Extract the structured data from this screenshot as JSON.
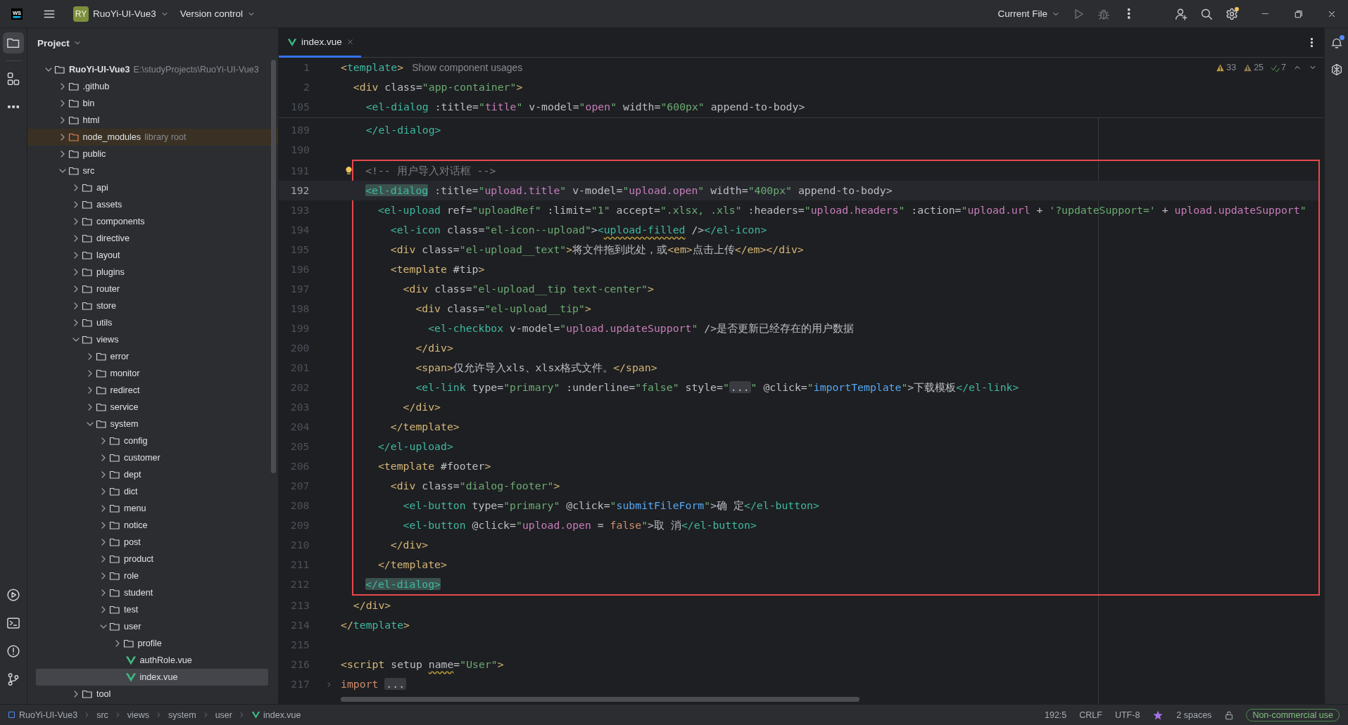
{
  "title_bar": {
    "logo": "WS",
    "project_badge": "RY",
    "project": "RuoYi-UI-Vue3",
    "vcs": "Version control",
    "run_config": "Current File",
    "settings_badge": true
  },
  "left_toolbar": {
    "top": [
      {
        "kind": "project",
        "selected": true
      },
      {
        "kind": "structure",
        "selected": false
      },
      {
        "kind": "more",
        "selected": false
      }
    ],
    "bottom": [
      {
        "kind": "services",
        "selected": false
      },
      {
        "kind": "terminal",
        "selected": false
      },
      {
        "kind": "problems",
        "selected": false
      },
      {
        "kind": "git",
        "selected": false
      }
    ]
  },
  "project_panel": {
    "title": "Project",
    "tree": [
      {
        "name": "RuoYi-UI-Vue3",
        "hint": "E:\\studyProjects\\RuoYi-UI-Vue3",
        "kind": "project",
        "expanded": true,
        "selected": false,
        "children": [
          {
            "name": ".github",
            "kind": "folder",
            "expanded": false,
            "selected": false
          },
          {
            "name": "bin",
            "kind": "folder",
            "expanded": false,
            "selected": false
          },
          {
            "name": "html",
            "kind": "folder",
            "expanded": false,
            "selected": false
          },
          {
            "name": "node_modules",
            "hint": "library root",
            "kind": "library",
            "expanded": false,
            "selected": false
          },
          {
            "name": "public",
            "kind": "folder",
            "expanded": false,
            "selected": false
          },
          {
            "name": "src",
            "kind": "folder",
            "expanded": true,
            "selected": false,
            "children": [
              {
                "name": "api",
                "kind": "folder",
                "expanded": false,
                "selected": false
              },
              {
                "name": "assets",
                "kind": "folder",
                "expanded": false,
                "selected": false
              },
              {
                "name": "components",
                "kind": "folder",
                "expanded": false,
                "selected": false
              },
              {
                "name": "directive",
                "kind": "folder",
                "expanded": false,
                "selected": false
              },
              {
                "name": "layout",
                "kind": "folder",
                "expanded": false,
                "selected": false
              },
              {
                "name": "plugins",
                "kind": "folder",
                "expanded": false,
                "selected": false
              },
              {
                "name": "router",
                "kind": "folder",
                "expanded": false,
                "selected": false
              },
              {
                "name": "store",
                "kind": "folder",
                "expanded": false,
                "selected": false
              },
              {
                "name": "utils",
                "kind": "folder",
                "expanded": false,
                "selected": false
              },
              {
                "name": "views",
                "kind": "folder",
                "expanded": true,
                "selected": false,
                "children": [
                  {
                    "name": "error",
                    "kind": "folder",
                    "expanded": false,
                    "selected": false
                  },
                  {
                    "name": "monitor",
                    "kind": "folder",
                    "expanded": false,
                    "selected": false
                  },
                  {
                    "name": "redirect",
                    "kind": "folder",
                    "expanded": false,
                    "selected": false
                  },
                  {
                    "name": "service",
                    "kind": "folder",
                    "expanded": false,
                    "selected": false
                  },
                  {
                    "name": "system",
                    "kind": "folder",
                    "expanded": true,
                    "selected": false,
                    "children": [
                      {
                        "name": "config",
                        "kind": "folder",
                        "expanded": false,
                        "selected": false
                      },
                      {
                        "name": "customer",
                        "kind": "folder",
                        "expanded": false,
                        "selected": false
                      },
                      {
                        "name": "dept",
                        "kind": "folder",
                        "expanded": false,
                        "selected": false
                      },
                      {
                        "name": "dict",
                        "kind": "folder",
                        "expanded": false,
                        "selected": false
                      },
                      {
                        "name": "menu",
                        "kind": "folder",
                        "expanded": false,
                        "selected": false
                      },
                      {
                        "name": "notice",
                        "kind": "folder",
                        "expanded": false,
                        "selected": false
                      },
                      {
                        "name": "post",
                        "kind": "folder",
                        "expanded": false,
                        "selected": false
                      },
                      {
                        "name": "product",
                        "kind": "folder",
                        "expanded": false,
                        "selected": false
                      },
                      {
                        "name": "role",
                        "kind": "folder",
                        "expanded": false,
                        "selected": false
                      },
                      {
                        "name": "student",
                        "kind": "folder",
                        "expanded": false,
                        "selected": false
                      },
                      {
                        "name": "test",
                        "kind": "folder",
                        "expanded": false,
                        "selected": false
                      },
                      {
                        "name": "user",
                        "kind": "folder",
                        "expanded": true,
                        "selected": false,
                        "children": [
                          {
                            "name": "profile",
                            "kind": "folder",
                            "expanded": false,
                            "selected": false
                          },
                          {
                            "name": "authRole.vue",
                            "kind": "vue",
                            "selected": false
                          },
                          {
                            "name": "index.vue",
                            "kind": "vue",
                            "selected": true
                          }
                        ]
                      }
                    ]
                  }
                ]
              },
              {
                "name": "tool",
                "kind": "folder",
                "expanded": false,
                "selected": false
              }
            ]
          }
        ]
      }
    ]
  },
  "editor": {
    "tabs": [
      {
        "label": "index.vue",
        "selected": true
      }
    ],
    "inspections": [
      {
        "kind": "warning",
        "count": "33"
      },
      {
        "kind": "weak_warning",
        "count": "25"
      },
      {
        "kind": "typo",
        "count": "7"
      }
    ],
    "sticky_lines": [
      {
        "number": "1",
        "code": [
          {
            "kind": "tag",
            "text": "<"
          },
          {
            "kind": "comp",
            "text": "template"
          },
          {
            "kind": "tag",
            "text": ">"
          }
        ],
        "hint": "Show component usages"
      },
      {
        "number": "2",
        "code": [
          {
            "kind": "tag",
            "text": "  <div"
          },
          {
            "kind": "attr",
            "text": " class="
          },
          {
            "kind": "str",
            "text": "\"app-container\""
          },
          {
            "kind": "tag",
            "text": ">"
          }
        ]
      },
      {
        "number": "105",
        "code": [
          {
            "kind": "comp",
            "text": "    <el-dialog"
          },
          {
            "kind": "attr",
            "text": " :title="
          },
          {
            "kind": "str",
            "text": "\""
          },
          {
            "kind": "var",
            "text": "title"
          },
          {
            "kind": "str",
            "text": "\""
          },
          {
            "kind": "attr",
            "text": " v-model="
          },
          {
            "kind": "str",
            "text": "\""
          },
          {
            "kind": "var",
            "text": "open"
          },
          {
            "kind": "str",
            "text": "\""
          },
          {
            "kind": "attr",
            "text": " width="
          },
          {
            "kind": "str",
            "text": "\"600px\""
          },
          {
            "kind": "attr",
            "text": " append-to-body>"
          }
        ]
      }
    ],
    "lines": [
      {
        "number": "189",
        "current": false,
        "boxed": false,
        "code": [
          {
            "kind": "comp",
            "text": "    </el-dialog>"
          }
        ]
      },
      {
        "number": "190",
        "current": false
      },
      {
        "number": "191",
        "current": false,
        "boxed": true,
        "code": [
          {
            "kind": "comment",
            "text": "    <!-- 用户导入对话框 -->"
          }
        ]
      },
      {
        "number": "192",
        "current": true,
        "boxed": true,
        "code": [
          {
            "kind": "compmatch",
            "text": "    <el-dialog"
          },
          {
            "kind": "attr",
            "text": " :title="
          },
          {
            "kind": "str",
            "text": "\""
          },
          {
            "kind": "var",
            "text": "upload.title"
          },
          {
            "kind": "str",
            "text": "\""
          },
          {
            "kind": "attr",
            "text": " v-model="
          },
          {
            "kind": "str",
            "text": "\""
          },
          {
            "kind": "var",
            "text": "upload.open"
          },
          {
            "kind": "str",
            "text": "\""
          },
          {
            "kind": "attr",
            "text": " width="
          },
          {
            "kind": "str",
            "text": "\"400px\""
          },
          {
            "kind": "attr",
            "text": " append-to-body>"
          }
        ]
      },
      {
        "number": "193",
        "current": false,
        "boxed": true,
        "code": [
          {
            "kind": "comp",
            "text": "      <el-upload"
          },
          {
            "kind": "attr",
            "text": " ref="
          },
          {
            "kind": "str",
            "text": "\"uploadRef\""
          },
          {
            "kind": "attr",
            "text": " :limit="
          },
          {
            "kind": "str",
            "text": "\"1\""
          },
          {
            "kind": "attr",
            "text": " accept="
          },
          {
            "kind": "str",
            "text": "\".xlsx, .xls\""
          },
          {
            "kind": "attr",
            "text": " :headers="
          },
          {
            "kind": "str",
            "text": "\""
          },
          {
            "kind": "var",
            "text": "upload.headers"
          },
          {
            "kind": "str",
            "text": "\""
          },
          {
            "kind": "attr",
            "text": " :action="
          },
          {
            "kind": "str",
            "text": "\""
          },
          {
            "kind": "var",
            "text": "upload.url"
          },
          {
            "kind": "text",
            "text": " + "
          },
          {
            "kind": "str",
            "text": "'?updateSupport='"
          },
          {
            "kind": "text",
            "text": " + "
          },
          {
            "kind": "var",
            "text": "upload.updateSupport"
          },
          {
            "kind": "str",
            "text": "\""
          }
        ]
      },
      {
        "number": "194",
        "current": false,
        "boxed": true,
        "code": [
          {
            "kind": "comp",
            "text": "        <el-icon"
          },
          {
            "kind": "attr",
            "text": " class="
          },
          {
            "kind": "str",
            "text": "\"el-icon--upload\""
          },
          {
            "kind": "attr",
            "text": ">"
          },
          {
            "kind": "comp",
            "text": "<"
          },
          {
            "kind": "compwarn",
            "text": "upload-filled"
          },
          {
            "kind": "attr",
            "text": " />"
          },
          {
            "kind": "comp",
            "text": "</el-icon>"
          }
        ]
      },
      {
        "number": "195",
        "current": false,
        "boxed": true,
        "code": [
          {
            "kind": "tag",
            "text": "        <div"
          },
          {
            "kind": "attr",
            "text": " class="
          },
          {
            "kind": "str",
            "text": "\"el-upload__text\""
          },
          {
            "kind": "tag",
            "text": ">"
          },
          {
            "kind": "text",
            "text": "将文件拖到此处，或"
          },
          {
            "kind": "tag",
            "text": "<em>"
          },
          {
            "kind": "text",
            "text": "点击上传"
          },
          {
            "kind": "tag",
            "text": "</em></div>"
          }
        ]
      },
      {
        "number": "196",
        "current": false,
        "boxed": true,
        "code": [
          {
            "kind": "tag",
            "text": "        <template"
          },
          {
            "kind": "attr",
            "text": " #tip"
          },
          {
            "kind": "tag",
            "text": ">"
          }
        ]
      },
      {
        "number": "197",
        "current": false,
        "boxed": true,
        "code": [
          {
            "kind": "tag",
            "text": "          <div"
          },
          {
            "kind": "attr",
            "text": " class="
          },
          {
            "kind": "str",
            "text": "\"el-upload__tip text-center\""
          },
          {
            "kind": "tag",
            "text": ">"
          }
        ]
      },
      {
        "number": "198",
        "current": false,
        "boxed": true,
        "code": [
          {
            "kind": "tag",
            "text": "            <div"
          },
          {
            "kind": "attr",
            "text": " class="
          },
          {
            "kind": "str",
            "text": "\"el-upload__tip\""
          },
          {
            "kind": "tag",
            "text": ">"
          }
        ]
      },
      {
        "number": "199",
        "current": false,
        "boxed": true,
        "code": [
          {
            "kind": "comp",
            "text": "              <el-checkbox"
          },
          {
            "kind": "attr",
            "text": " v-model="
          },
          {
            "kind": "str",
            "text": "\""
          },
          {
            "kind": "var",
            "text": "upload.updateSupport"
          },
          {
            "kind": "str",
            "text": "\""
          },
          {
            "kind": "attr",
            "text": " />"
          },
          {
            "kind": "text",
            "text": "是否更新已经存在的用户数据"
          }
        ]
      },
      {
        "number": "200",
        "current": false,
        "boxed": true,
        "code": [
          {
            "kind": "tag",
            "text": "            </div>"
          }
        ]
      },
      {
        "number": "201",
        "current": false,
        "boxed": true,
        "code": [
          {
            "kind": "tag",
            "text": "            <span>"
          },
          {
            "kind": "text",
            "text": "仅允许导入xls、xlsx格式文件。"
          },
          {
            "kind": "tag",
            "text": "</span>"
          }
        ]
      },
      {
        "number": "202",
        "current": false,
        "boxed": true,
        "code": [
          {
            "kind": "comp",
            "text": "            <el-link"
          },
          {
            "kind": "attr",
            "text": " type="
          },
          {
            "kind": "str",
            "text": "\"primary\""
          },
          {
            "kind": "attr",
            "text": " :underline="
          },
          {
            "kind": "str",
            "text": "\"false\""
          },
          {
            "kind": "attr",
            "text": " style="
          },
          {
            "kind": "str",
            "text": "\""
          },
          {
            "kind": "fold",
            "text": "..."
          },
          {
            "kind": "str",
            "text": "\""
          },
          {
            "kind": "attr",
            "text": " @click="
          },
          {
            "kind": "str",
            "text": "\""
          },
          {
            "kind": "fn",
            "text": "importTemplate"
          },
          {
            "kind": "str",
            "text": "\""
          },
          {
            "kind": "attr",
            "text": ">"
          },
          {
            "kind": "text",
            "text": "下载模板"
          },
          {
            "kind": "comp",
            "text": "</el-link>"
          }
        ]
      },
      {
        "number": "203",
        "current": false,
        "boxed": true,
        "code": [
          {
            "kind": "tag",
            "text": "          </div>"
          }
        ]
      },
      {
        "number": "204",
        "current": false,
        "boxed": true,
        "code": [
          {
            "kind": "tag",
            "text": "        </template>"
          }
        ]
      },
      {
        "number": "205",
        "current": false,
        "boxed": true,
        "code": [
          {
            "kind": "comp",
            "text": "      </el-upload>"
          }
        ]
      },
      {
        "number": "206",
        "current": false,
        "boxed": true,
        "code": [
          {
            "kind": "tag",
            "text": "      <template"
          },
          {
            "kind": "attr",
            "text": " #footer"
          },
          {
            "kind": "tag",
            "text": ">"
          }
        ]
      },
      {
        "number": "207",
        "current": false,
        "boxed": true,
        "code": [
          {
            "kind": "tag",
            "text": "        <div"
          },
          {
            "kind": "attr",
            "text": " class="
          },
          {
            "kind": "str",
            "text": "\"dialog-footer\""
          },
          {
            "kind": "tag",
            "text": ">"
          }
        ]
      },
      {
        "number": "208",
        "current": false,
        "boxed": true,
        "code": [
          {
            "kind": "comp",
            "text": "          <el-button"
          },
          {
            "kind": "attr",
            "text": " type="
          },
          {
            "kind": "str",
            "text": "\"primary\""
          },
          {
            "kind": "attr",
            "text": " @click="
          },
          {
            "kind": "str",
            "text": "\""
          },
          {
            "kind": "fn",
            "text": "submitFileForm"
          },
          {
            "kind": "str",
            "text": "\""
          },
          {
            "kind": "attr",
            "text": ">"
          },
          {
            "kind": "text",
            "text": "确 定"
          },
          {
            "kind": "comp",
            "text": "</el-button>"
          }
        ]
      },
      {
        "number": "209",
        "current": false,
        "boxed": true,
        "code": [
          {
            "kind": "comp",
            "text": "          <el-button"
          },
          {
            "kind": "attr",
            "text": " @click="
          },
          {
            "kind": "str",
            "text": "\""
          },
          {
            "kind": "var",
            "text": "upload.open"
          },
          {
            "kind": "text",
            "text": " = "
          },
          {
            "kind": "kw",
            "text": "false"
          },
          {
            "kind": "str",
            "text": "\""
          },
          {
            "kind": "attr",
            "text": ">"
          },
          {
            "kind": "text",
            "text": "取 消"
          },
          {
            "kind": "comp",
            "text": "</el-button>"
          }
        ]
      },
      {
        "number": "210",
        "current": false,
        "boxed": true,
        "code": [
          {
            "kind": "tag",
            "text": "        </div>"
          }
        ]
      },
      {
        "number": "211",
        "current": false,
        "boxed": true,
        "code": [
          {
            "kind": "tag",
            "text": "      </template>"
          }
        ]
      },
      {
        "number": "212",
        "current": false,
        "boxed": true,
        "code": [
          {
            "kind": "compmatch",
            "text": "    </el-dialog>"
          }
        ]
      },
      {
        "number": "213",
        "current": false,
        "boxed": false,
        "code": [
          {
            "kind": "tag",
            "text": "  </div>"
          }
        ]
      },
      {
        "number": "214",
        "current": false,
        "boxed": false,
        "code": [
          {
            "kind": "tag",
            "text": "</"
          },
          {
            "kind": "comp",
            "text": "template"
          },
          {
            "kind": "tag",
            "text": ">"
          }
        ]
      },
      {
        "number": "215",
        "current": false
      },
      {
        "number": "216",
        "current": false,
        "boxed": false,
        "code": [
          {
            "kind": "tag",
            "text": "<script"
          },
          {
            "kind": "attr",
            "text": " setup "
          },
          {
            "kind": "attrwarn",
            "text": "name"
          },
          {
            "kind": "attr",
            "text": "="
          },
          {
            "kind": "str",
            "text": "\"User\""
          },
          {
            "kind": "tag",
            "text": ">"
          }
        ]
      },
      {
        "number": "217",
        "current": false,
        "boxed": false,
        "code": [
          {
            "kind": "kw",
            "text": "import "
          },
          {
            "kind": "folded",
            "text": "..."
          }
        ]
      }
    ]
  },
  "right_toolbar": [
    {
      "kind": "notifications",
      "badge": true
    },
    {
      "kind": "ai",
      "badge": false
    }
  ],
  "status_bar": {
    "breadcrumbs": [
      "RuoYi-UI-Vue3",
      "src",
      "views",
      "system",
      "user",
      "index.vue"
    ],
    "position": "192:5",
    "line_separator": "CRLF",
    "encoding": "UTF-8",
    "indent": "2 spaces",
    "license": "Non-commercial use"
  }
}
